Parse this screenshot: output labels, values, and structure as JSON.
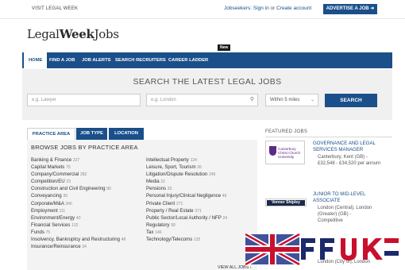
{
  "header": {
    "visit_link": "VISIT LEGAL WEEK",
    "jobseekers_link": "Jobseekers:",
    "sign_in": "Sign in",
    "or_text": "or",
    "create_account": "Create account",
    "advertise_button": "ADVERTISE A JOB ➜"
  },
  "logo": {
    "legal": "Legal",
    "week": "Week",
    "jobs": "Jobs"
  },
  "nav": {
    "items": [
      "HOME",
      "FIND A JOB",
      "JOB ALERTS",
      "SEARCH RECRUITERS",
      "CAREER LADDER"
    ],
    "new_badge": "New"
  },
  "search": {
    "title": "SEARCH THE LATEST LEGAL JOBS",
    "keyword_placeholder": "e.g. Lawyer",
    "location_placeholder": "e.g. London",
    "radius_value": "Within 5 miles",
    "button": "SEARCH"
  },
  "browse": {
    "tabs": [
      "PRACTICE AREA",
      "JOB TYPE",
      "LOCATION"
    ],
    "title": "BROWSE JOBS BY PRACTICE AREA",
    "left_column": [
      {
        "label": "Banking & Finance",
        "count": "227"
      },
      {
        "label": "Capital Markets",
        "count": "75"
      },
      {
        "label": "Company/Commercial",
        "count": "282"
      },
      {
        "label": "Competition/EU",
        "count": "23"
      },
      {
        "label": "Construction and Civil Engineering",
        "count": "80"
      },
      {
        "label": "Conveyancing",
        "count": "39"
      },
      {
        "label": "Corporate/M&A",
        "count": "340"
      },
      {
        "label": "Employment",
        "count": "111"
      },
      {
        "label": "Environment/Energy",
        "count": "40"
      },
      {
        "label": "Financial Services",
        "count": "132"
      },
      {
        "label": "Funds",
        "count": "75"
      },
      {
        "label": "Insolvency, Bankruptcy and Restructuring",
        "count": "48"
      },
      {
        "label": "Insurance/Reinsurance",
        "count": "34"
      }
    ],
    "right_column": [
      {
        "label": "Intellectual Property",
        "count": "124"
      },
      {
        "label": "Leisure, Sport, Tourism",
        "count": "26"
      },
      {
        "label": "Litigation/Dispute Resolution",
        "count": "249"
      },
      {
        "label": "Media",
        "count": "22"
      },
      {
        "label": "Pensions",
        "count": "33"
      },
      {
        "label": "Personal Injury/Clinical Negligence",
        "count": "45"
      },
      {
        "label": "Private Client",
        "count": "271"
      },
      {
        "label": "Property / Real Estate",
        "count": "371"
      },
      {
        "label": "Public Sector/Local Authority / NFP",
        "count": "24"
      },
      {
        "label": "Regulatory",
        "count": "99"
      },
      {
        "label": "Tax",
        "count": "140"
      },
      {
        "label": "Technology/Telecoms",
        "count": "125"
      }
    ],
    "view_all": "VIEW ALL JOBS ›"
  },
  "featured": {
    "heading": "FEATURED JOBS",
    "jobs": [
      {
        "logo_text": "Canterbury Christ Church University",
        "title": "GOVERNANCE AND LEGAL SERVICES MANAGER",
        "location": "Canterbury, Kent (GB) -",
        "salary": "£32,548 - £34,520 per annum"
      },
      {
        "logo_text": "Venner Shipley",
        "title": "JUNIOR TO MID-LEVEL ASSOCIATE",
        "location": "London (Central), London (Greater) (GB) -",
        "salary": "Competitive"
      },
      {
        "location": "London (City of), London"
      }
    ]
  },
  "colors": {
    "brand_blue": "#1a4f8a",
    "search_band": "#f0f0f0",
    "panel_bg": "#f3f3f3"
  }
}
